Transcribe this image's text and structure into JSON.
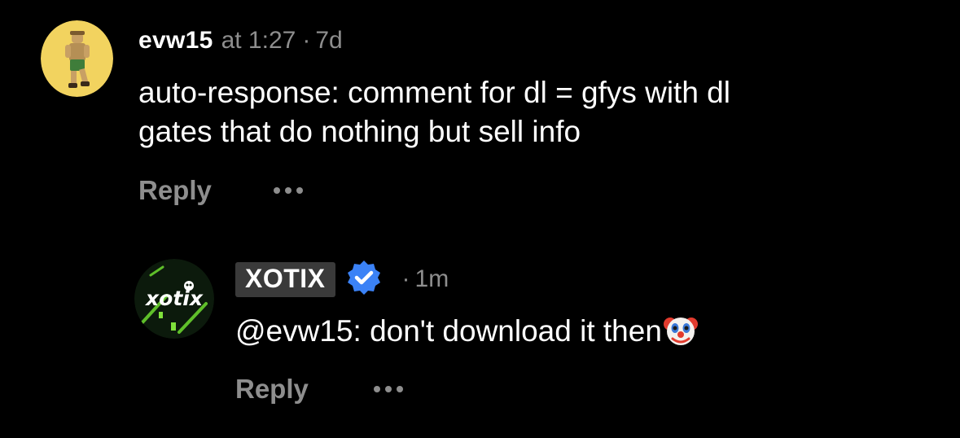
{
  "comments": [
    {
      "username": "evw15",
      "at_label": "at 1:27",
      "separator": "·",
      "age": "7d",
      "text_line1": "auto-response: comment for dl = gfys with dl",
      "text_line2": "gates that do nothing but sell info",
      "reply_label": "Reply",
      "avatar_bg": "#f2d35f"
    },
    {
      "username": "XOTIX",
      "verified": true,
      "separator": "·",
      "age": "1m",
      "mention": "@evw15:",
      "text": "don't download it then",
      "emoji": "clown-face",
      "reply_label": "Reply",
      "avatar_logo_text": "xotix",
      "accent": "#3b82f6"
    }
  ],
  "colors": {
    "background": "#000000",
    "text": "#ffffff",
    "secondary": "#8e8e8e",
    "creator_tag_bg": "#3a3a3a",
    "verified_badge": "#3b82f6"
  }
}
